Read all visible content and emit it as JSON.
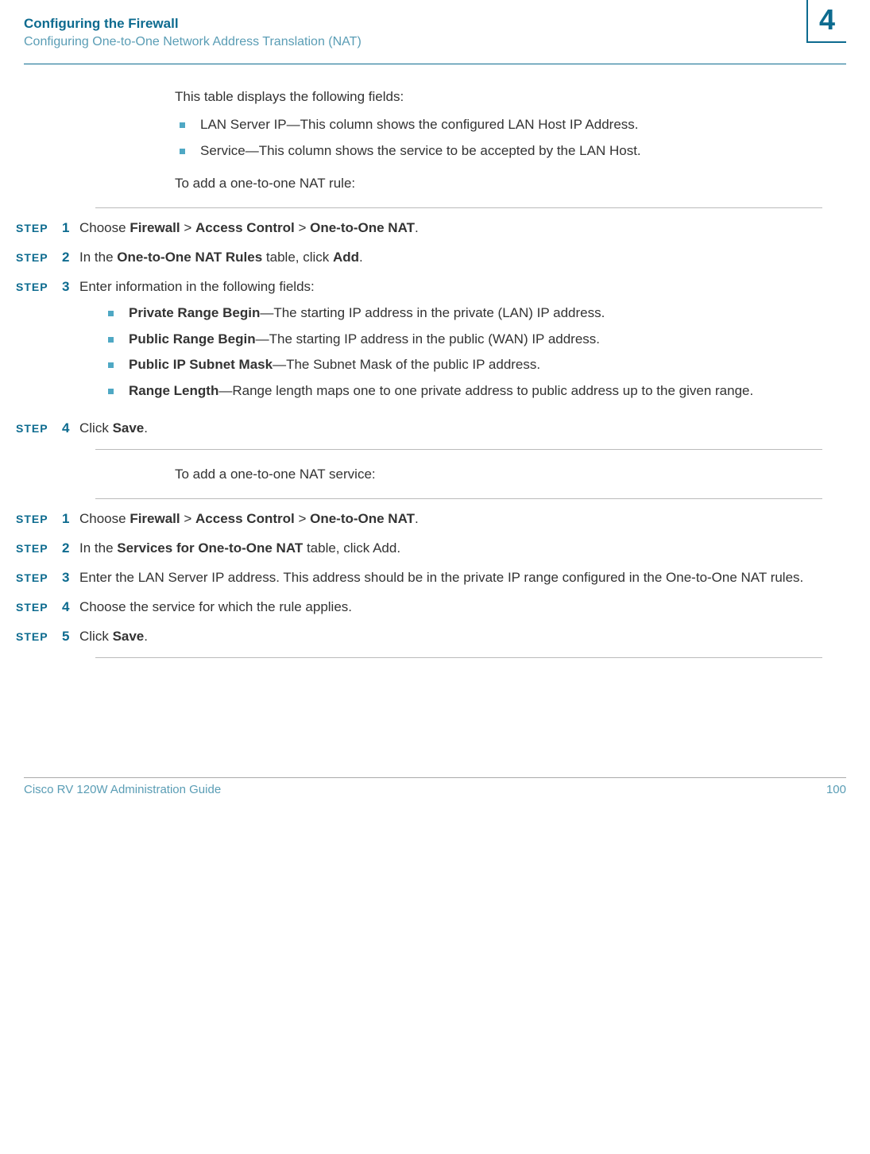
{
  "header": {
    "title": "Configuring the Firewall",
    "subtitle": "Configuring One-to-One Network Address Translation (NAT)",
    "chapter": "4"
  },
  "body": {
    "intro": "This table displays the following fields:",
    "introBullets": {
      "b0": {
        "label": "LAN Server IP",
        "text": "—This column shows the configured LAN Host IP Address."
      },
      "b1": {
        "label": "Service",
        "text": "—This column shows the service to be accepted by the LAN Host."
      }
    },
    "lead1": "To add a one-to-one NAT rule:",
    "steps1": {
      "s1": {
        "pre": "Choose ",
        "b1": "Firewall",
        "sep1": " > ",
        "b2": "Access Control",
        "sep2": " > ",
        "b3": "One-to-One NAT",
        "post": "."
      },
      "s2": {
        "pre": "In the ",
        "b1": "One-to-One NAT Rules",
        "mid": " table, click ",
        "b2": "Add",
        "post": "."
      },
      "s3": {
        "text": "Enter information in the following fields:"
      },
      "s3bullets": {
        "b0": {
          "label": "Private Range Begin",
          "text": "—The starting IP address in the private (LAN) IP address."
        },
        "b1": {
          "label": "Public Range Begin",
          "text": "—The starting IP address in the public (WAN) IP address."
        },
        "b2": {
          "label": "Public IP Subnet Mask",
          "text": "—The Subnet Mask of the public IP address."
        },
        "b3": {
          "label": "Range Length",
          "text": "—Range length maps one to one private address to public address up to the given range."
        }
      },
      "s4": {
        "pre": "Click ",
        "b1": "Save",
        "post": "."
      }
    },
    "lead2": "To add a one-to-one NAT service:",
    "steps2": {
      "s1": {
        "pre": "Choose ",
        "b1": "Firewall",
        "sep1": " > ",
        "b2": "Access Control",
        "sep2": " > ",
        "b3": "One-to-One NAT",
        "post": "."
      },
      "s2": {
        "pre": "In the ",
        "b1": "Services for One-to-One NAT",
        "mid": " table, click Add."
      },
      "s3": {
        "text": "Enter the LAN Server IP address. This address should be in the private IP range configured in the One-to-One NAT rules."
      },
      "s4": {
        "text": "Choose the service for which the rule applies."
      },
      "s5": {
        "pre": "Click ",
        "b1": "Save",
        "post": "."
      }
    },
    "stepWord": "STEP"
  },
  "footer": {
    "left": "Cisco RV 120W Administration Guide",
    "right": "100"
  }
}
